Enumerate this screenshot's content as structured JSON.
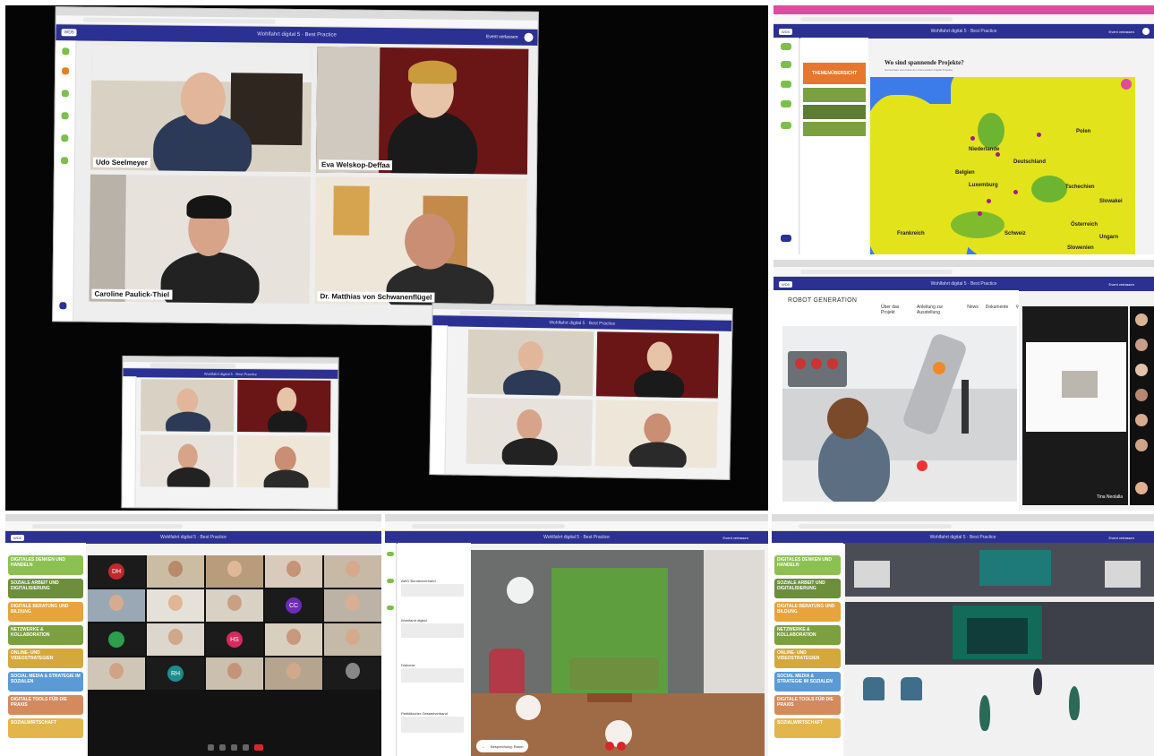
{
  "app": {
    "header_title": "Wohlfahrt digital 5 · Best Practice",
    "exit_label": "Event verlassen"
  },
  "projector": {
    "participants": [
      {
        "name": "Udo Seelmeyer"
      },
      {
        "name": "Eva Welskop-Deffaa"
      },
      {
        "name": "Caroline Paulick-Thiel"
      },
      {
        "name": "Dr. Matthias von Schwanenflügel"
      }
    ]
  },
  "map_panel": {
    "question": "Wo sind spannende Projekte?",
    "subtitle": "Gemeinsam eine Karte der interessanten Digital-Projekte",
    "sidebar_cards": [
      "THEMENÜBERSICHT",
      "",
      "",
      ""
    ],
    "labels": [
      "Polen",
      "Niederlande",
      "Deutschland",
      "Belgien",
      "Luxemburg",
      "Tschechien",
      "Slowakei",
      "Schweiz",
      "Österreich",
      "Frankreich",
      "Ungarn",
      "Slowenien"
    ]
  },
  "robot_panel": {
    "brand": "ROBOT GENERATION",
    "nav": [
      "Über das Projekt",
      "Anleitung zur Ausstellung",
      "News",
      "Dokumente"
    ],
    "speaker_name": "Tina Neolalla"
  },
  "grid_panel": {
    "categories": [
      "DIGITALES DENKEN UND HANDELN",
      "SOZIALE ARBEIT UND DIGITALISIERUNG",
      "DIGITALE BERATUNG UND BILDUNG",
      "NETZWERKE & KOLLABORATION",
      "ONLINE- UND VIDEOSTRATEGIEN",
      "SOCIAL MEDIA & STRATEGIE IM SOZIALEN",
      "DIGITALE TOOLS FÜR DIE PRAXIS",
      "SOZIALWIRTSCHAFT"
    ],
    "avatars": [
      "DH",
      "CC",
      "HS",
      "RH"
    ]
  },
  "room_panel": {
    "feed": [
      {
        "author": "AWO Bundesverband"
      },
      {
        "author": "Wohlfahrt digital"
      },
      {
        "author": "Diakonie"
      },
      {
        "author": "Paritätischer Gesamtverband"
      }
    ],
    "bottom_label": "Besprechung: Raum"
  },
  "colors": {
    "header_blue": "#2b3192",
    "cat_colors": [
      "#8cc152",
      "#6d8e3b",
      "#e8a33d",
      "#7aa040",
      "#d4a83c",
      "#5c9ad6",
      "#d48a5c",
      "#e3b54d"
    ]
  }
}
